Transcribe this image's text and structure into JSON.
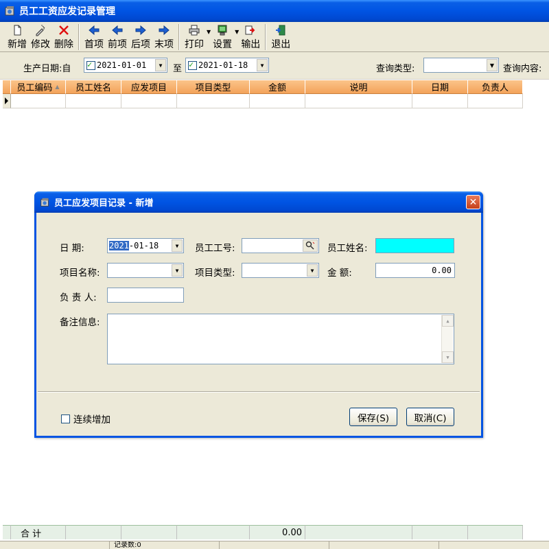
{
  "window": {
    "title": "员工工资应发记录管理",
    "icon": "app-icon"
  },
  "toolbar": {
    "buttons": [
      {
        "label": "新增",
        "icon": "new-icon"
      },
      {
        "label": "修改",
        "icon": "edit-icon"
      },
      {
        "label": "删除",
        "icon": "delete-icon"
      },
      {
        "label": "首项",
        "icon": "first-icon"
      },
      {
        "label": "前项",
        "icon": "prev-icon"
      },
      {
        "label": "后项",
        "icon": "next-icon"
      },
      {
        "label": "末项",
        "icon": "last-icon"
      },
      {
        "label": "打印",
        "icon": "print-icon"
      },
      {
        "label": "设置",
        "icon": "settings-icon"
      },
      {
        "label": "输出",
        "icon": "export-icon"
      },
      {
        "label": "退出",
        "icon": "exit-icon"
      }
    ]
  },
  "filter": {
    "date_label": "生产日期:自",
    "date_from": "2021-01-01",
    "to_label": "至",
    "date_to": "2021-01-18",
    "query_type_label": "查询类型:",
    "query_type_value": "",
    "query_content_label": "查询内容:"
  },
  "grid": {
    "columns": [
      "员工编码",
      "员工姓名",
      "应发项目",
      "项目类型",
      "金额",
      "说明",
      "日期",
      "负责人"
    ],
    "rows": [
      [
        "",
        "",
        "",
        "",
        "",
        "",
        "",
        ""
      ]
    ]
  },
  "summary": {
    "label": "合 计",
    "amount": "0.00"
  },
  "status": {
    "record_count": "记录数:0"
  },
  "dialog": {
    "title": "员工应发项目记录 - 新增",
    "fields": {
      "date_label": "日    期:",
      "date_sel": "2021",
      "date_rest": "-01-18",
      "emp_no_label": "员工工号:",
      "emp_no_value": "",
      "emp_name_label": "员工姓名:",
      "emp_name_value": "",
      "item_name_label": "项目名称:",
      "item_name_value": "",
      "item_type_label": "项目类型:",
      "item_type_value": "",
      "amount_label": "金    额:",
      "amount_value": "0.00",
      "manager_label": "负 责 人:",
      "manager_value": "",
      "remark_label": "备注信息:",
      "remark_value": ""
    },
    "continue_add_label": "连续增加",
    "continue_add_checked": false,
    "save_label": "保存(S)",
    "cancel_label": "取消(C)",
    "emp_name_bg": "#00ffff"
  }
}
